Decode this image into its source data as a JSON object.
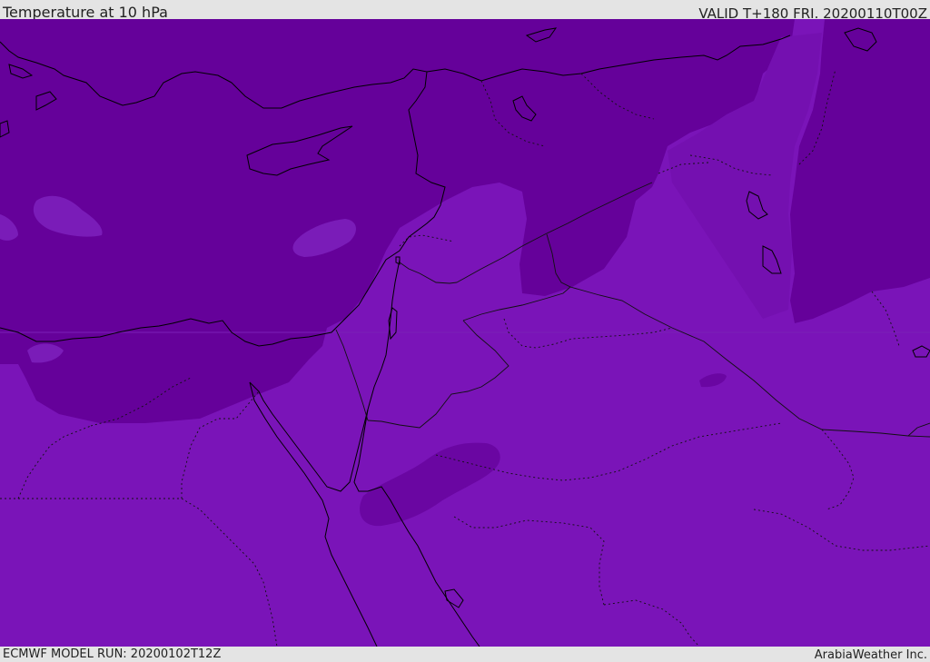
{
  "header": {
    "title": "Temperature at 10 hPa",
    "valid": "VALID T+180 FRI. 20200110T00Z"
  },
  "footer": {
    "model_run": "ECMWF MODEL RUN: 20200102T12Z",
    "credit": "ArabiaWeather Inc."
  },
  "map": {
    "colors": {
      "cold_band": "#65019a",
      "mid_band": "#7410b0",
      "warm_band": "#7a14b8",
      "lighter_patch": "#7a1cb8",
      "coast_line": "#000000",
      "border_line": "#111111"
    }
  }
}
